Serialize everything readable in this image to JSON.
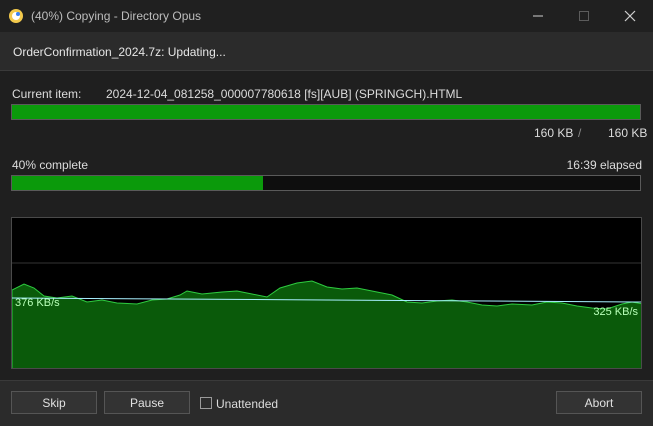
{
  "window": {
    "title": "(40%) Copying - Directory Opus",
    "icon": "directory-opus-icon"
  },
  "status": {
    "text": "OrderConfirmation_2024.7z: Updating..."
  },
  "current_item": {
    "label": "Current item:",
    "filename": "2024-12-04_081258_000007780618 [fs][AUB] (SPRINGCH).HTML",
    "size_done": "160 KB",
    "separator": "/",
    "size_total": "160 KB",
    "progress": 1.0
  },
  "overall": {
    "label": "40% complete",
    "elapsed": "16:39 elapsed",
    "progress": 0.4
  },
  "graph": {
    "rate_left": "376 KB/s",
    "rate_right": "325 KB/s",
    "fill_color": "#0a5a0a",
    "line_color": "#2ecc40"
  },
  "footer": {
    "skip_label": "Skip",
    "pause_label": "Pause",
    "unattended_label": "Unattended",
    "unattended_checked": false,
    "abort_label": "Abort"
  }
}
